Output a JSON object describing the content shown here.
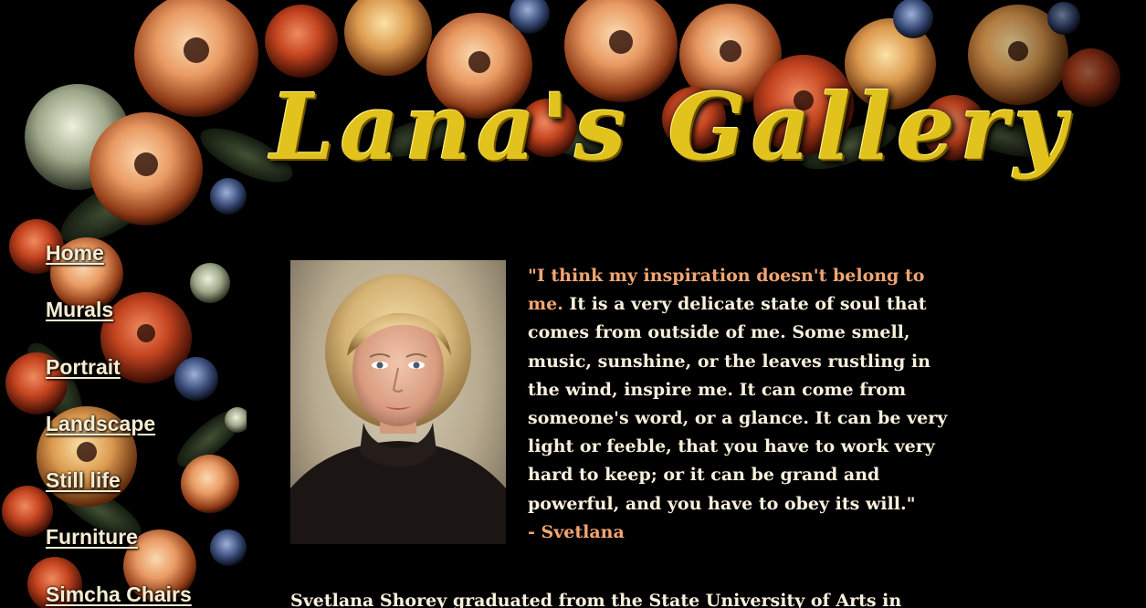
{
  "site": {
    "logo_part1": "Lana's",
    "logo_part2": "Gallery",
    "logo_color": "#e2c21c"
  },
  "nav": {
    "items": [
      {
        "label": "Home"
      },
      {
        "label": "Murals"
      },
      {
        "label": "Portrait"
      },
      {
        "label": "Landscape"
      },
      {
        "label": "Still life"
      },
      {
        "label": "Furniture"
      },
      {
        "label": "Simcha Chairs"
      }
    ]
  },
  "content": {
    "quote_accent": "\"I think my inspiration doesn't belong to me.",
    "quote_body": " It is a very delicate state of soul that comes from outside of me. Some smell, music, sunshine, or the leaves rustling in the wind, inspire me. It can come from someone's word, or a glance. It can be very light or feeble, that you have to work very hard to keep; or it can be grand and powerful, and you have to obey its will.\"",
    "quote_attribution": "- Svetlana",
    "bio_text": "Svetlana Shorey graduated from the State University of Arts in"
  },
  "colors": {
    "background": "#000000",
    "nav_text": "#f6ecd2",
    "body_text": "#f8f0dc",
    "accent_text": "#f2a672"
  }
}
